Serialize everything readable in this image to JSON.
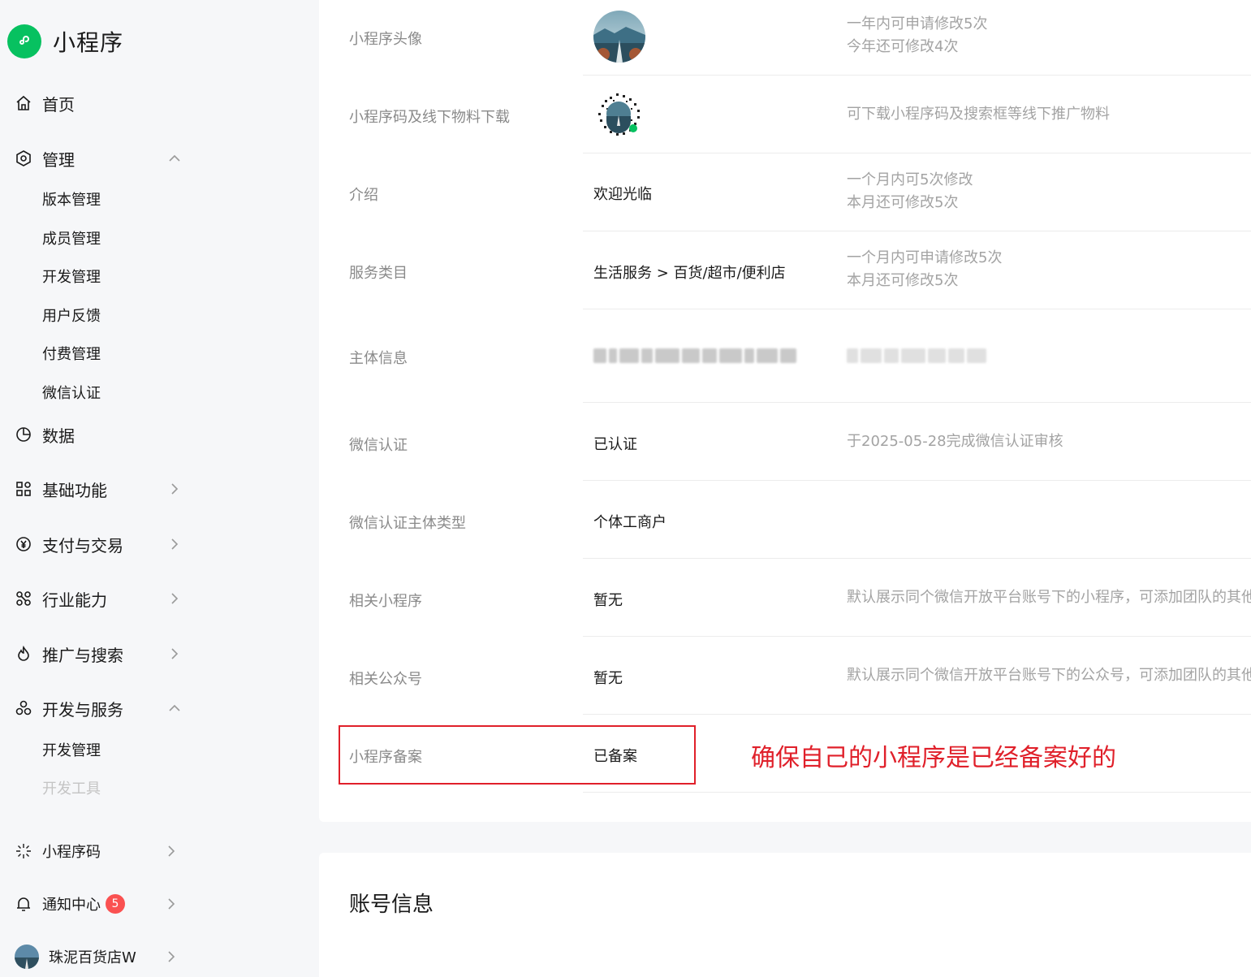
{
  "brand": {
    "name": "小程序",
    "logo_icon": "miniprogram-logo-icon",
    "color": "#07c160"
  },
  "sidebar": {
    "home": "首页",
    "manage": "管理",
    "manage_items": [
      "版本管理",
      "成员管理",
      "开发管理",
      "用户反馈",
      "付费管理",
      "微信认证"
    ],
    "data": "数据",
    "basic": "基础功能",
    "payment": "支付与交易",
    "industry": "行业能力",
    "promotion": "推广与搜索",
    "dev_service": "开发与服务",
    "dev_items": [
      "开发管理",
      "开发工具"
    ],
    "qrcode": "小程序码",
    "notify": "通知中心",
    "notify_count": "5",
    "account": "珠泥百货店W"
  },
  "info": {
    "avatar": {
      "label": "小程序头像",
      "desc1": "一年内可申请修改5次",
      "desc2": "今年还可修改4次"
    },
    "qrcode": {
      "label": "小程序码及线下物料下载",
      "desc": "可下载小程序码及搜索框等线下推广物料"
    },
    "intro": {
      "label": "介绍",
      "value": "欢迎光临",
      "desc1": "一个月内可5次修改",
      "desc2": "本月还可修改5次"
    },
    "category": {
      "label": "服务类目",
      "value": "生活服务 > 百货/超市/便利店",
      "desc1": "一个月内可申请修改5次",
      "desc2": "本月还可修改5次"
    },
    "subject": {
      "label": "主体信息"
    },
    "cert": {
      "label": "微信认证",
      "value": "已认证",
      "desc": "于2025-05-28完成微信认证审核"
    },
    "cert_type": {
      "label": "微信认证主体类型",
      "value": "个体工商户"
    },
    "related_mp": {
      "label": "相关小程序",
      "value": "暂无",
      "desc": "默认展示同个微信开放平台账号下的小程序，可添加团队的其他小"
    },
    "related_oa": {
      "label": "相关公众号",
      "value": "暂无",
      "desc": "默认展示同个微信开放平台账号下的公众号，可添加团队的其他公"
    },
    "filing": {
      "label": "小程序备案",
      "value": "已备案"
    }
  },
  "annotation": "确保自己的小程序是已经备案好的",
  "account_section": {
    "title": "账号信息"
  }
}
